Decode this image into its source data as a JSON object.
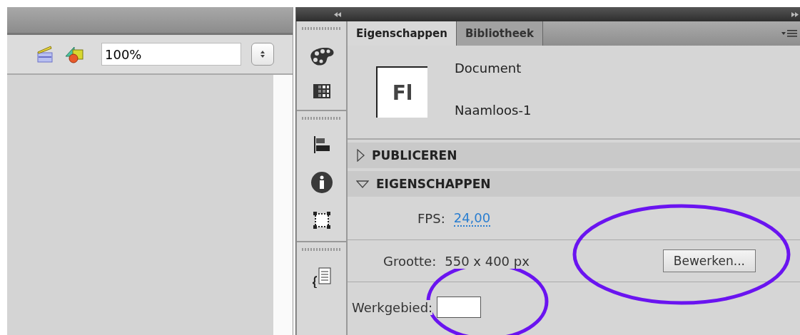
{
  "toolbar": {
    "zoom": {
      "value": "100%"
    }
  },
  "panel": {
    "tabs": [
      {
        "label": "Eigenschappen",
        "selected": true
      },
      {
        "label": "Bibliotheek",
        "selected": false
      }
    ],
    "document": {
      "icon_text": "Fl",
      "type": "Document",
      "name": "Naamloos-1"
    },
    "sections": [
      {
        "title": "PUBLICEREN",
        "expanded": false
      },
      {
        "title": "EIGENSCHAPPEN",
        "expanded": true,
        "fields": [
          {
            "kind": "link",
            "label": "FPS:",
            "value": "24,00"
          },
          {
            "kind": "size",
            "label": "Grootte:",
            "value": "550 x 400 px",
            "button": "Bewerken..."
          },
          {
            "kind": "swatch",
            "label": "Werkgebied:"
          }
        ]
      }
    ]
  }
}
